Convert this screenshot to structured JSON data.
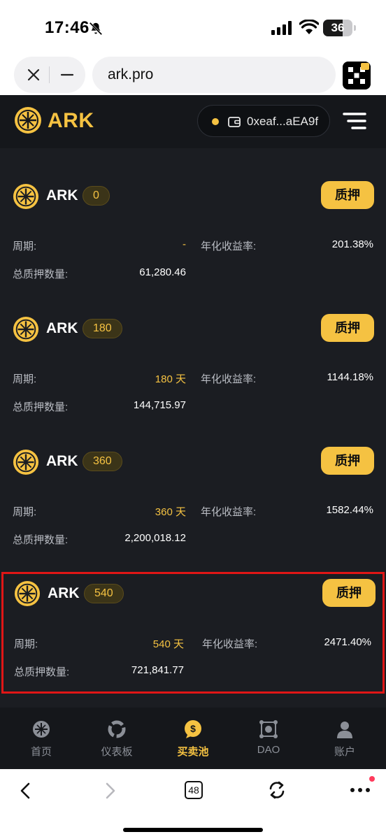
{
  "status_bar": {
    "time": "17:46",
    "battery": "36",
    "icons": [
      "bell-slash-icon",
      "signal-icon",
      "wifi-icon",
      "battery-icon"
    ]
  },
  "browser": {
    "url": "ark.pro",
    "tab_count": "48"
  },
  "header": {
    "brand": "ARK",
    "wallet_address": "0xeaf...aEA9f"
  },
  "labels": {
    "period": "周期:",
    "apy": "年化收益率:",
    "total_staked": "总质押数量:",
    "stake_button": "质押"
  },
  "pools": [
    {
      "name": "ARK",
      "badge": "0",
      "period": "-",
      "apy": "201.38%",
      "total": "61,280.46",
      "highlighted": false
    },
    {
      "name": "ARK",
      "badge": "180",
      "period": "180 天",
      "apy": "1144.18%",
      "total": "144,715.97",
      "highlighted": false
    },
    {
      "name": "ARK",
      "badge": "360",
      "period": "360 天",
      "apy": "1582.44%",
      "total": "2,200,018.12",
      "highlighted": false
    },
    {
      "name": "ARK",
      "badge": "540",
      "period": "540 天",
      "apy": "2471.40%",
      "total": "721,841.77",
      "highlighted": true
    }
  ],
  "nav": [
    {
      "label": "首页",
      "icon": "home-icon",
      "active": false
    },
    {
      "label": "仪表板",
      "icon": "dashboard-icon",
      "active": false
    },
    {
      "label": "买卖池",
      "icon": "coin-pool-icon",
      "active": true
    },
    {
      "label": "DAO",
      "icon": "dao-icon",
      "active": false
    },
    {
      "label": "账户",
      "icon": "account-icon",
      "active": false
    }
  ],
  "colors": {
    "accent": "#f5c242",
    "background": "#1b1d22",
    "header": "#15171b",
    "highlight_border": "#e01616"
  }
}
